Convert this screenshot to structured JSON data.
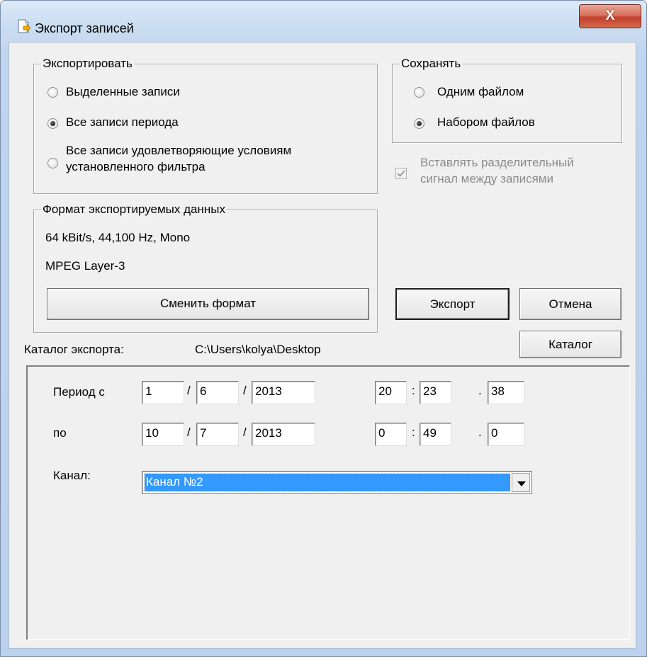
{
  "window": {
    "title": "Экспорт записей",
    "close_label": "X"
  },
  "export_group": {
    "legend": "Экспортировать",
    "options": [
      {
        "label": "Выделенные записи",
        "selected": false
      },
      {
        "label": "Все записи периода",
        "selected": true
      },
      {
        "label_line1": "Все записи удовлетворяющие условиям",
        "label_line2": "установленного фильтра",
        "selected": false
      }
    ]
  },
  "save_group": {
    "legend": "Сохранять",
    "options": [
      {
        "label": "Одним файлом",
        "selected": false
      },
      {
        "label": "Набором файлов",
        "selected": true
      }
    ]
  },
  "separator_checkbox": {
    "label_line1": "Вставлять разделительный",
    "label_line2": "сигнал между записями",
    "checked": true,
    "disabled": true
  },
  "format_group": {
    "legend": "Формат экспортируемых данных",
    "line1": "64 kBit/s, 44,100 Hz, Mono",
    "line2": "MPEG Layer-3",
    "change_button": "Сменить формат"
  },
  "buttons": {
    "export": "Экспорт",
    "cancel": "Отмена",
    "catalog": "Каталог"
  },
  "catalog": {
    "label": "Каталог экспорта:",
    "path": "C:\\Users\\kolya\\Desktop"
  },
  "period": {
    "from_label": "Период с",
    "to_label": "по",
    "from": {
      "day": "1",
      "month": "6",
      "year": "2013",
      "hour": "20",
      "minute": "23",
      "second": "38"
    },
    "to": {
      "day": "10",
      "month": "7",
      "year": "2013",
      "hour": "0",
      "minute": "49",
      "second": "0"
    },
    "date_sep": "/",
    "time_sep": ":",
    "sec_sep": "."
  },
  "channel": {
    "label": "Канал:",
    "value": "Канал №2"
  }
}
